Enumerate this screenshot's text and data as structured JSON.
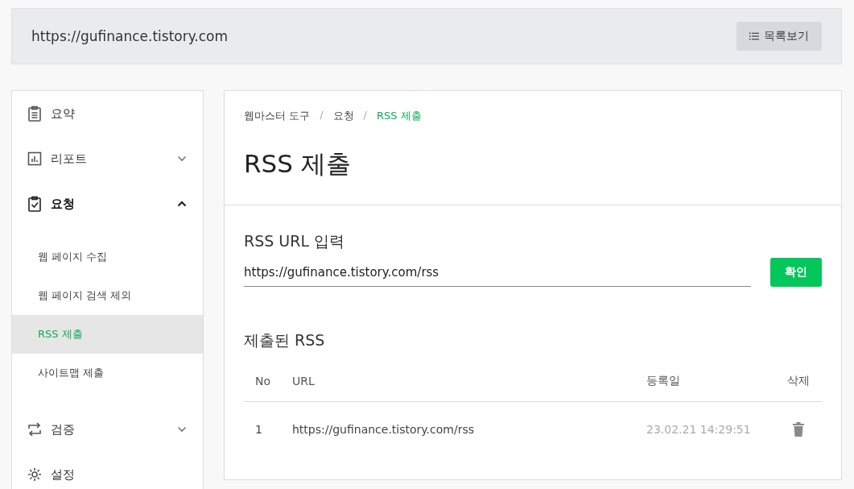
{
  "header": {
    "url": "https://gufinance.tistory.com",
    "list_button": "목록보기"
  },
  "sidebar": {
    "items": [
      {
        "label": "요약"
      },
      {
        "label": "리포트",
        "expanded": false
      },
      {
        "label": "요청",
        "expanded": true,
        "children": [
          {
            "label": "웹 페이지 수집",
            "selected": false
          },
          {
            "label": "웹 페이지 검색 제외",
            "selected": false
          },
          {
            "label": "RSS 제출",
            "selected": true
          },
          {
            "label": "사이트맵 제출",
            "selected": false
          }
        ]
      },
      {
        "label": "검증",
        "expanded": false
      },
      {
        "label": "설정"
      }
    ]
  },
  "breadcrumb": [
    {
      "label": "웹마스터 도구",
      "selected": false
    },
    {
      "separator": "/",
      "label": "요청",
      "selected": false
    },
    {
      "separator": "/",
      "label": "RSS 제출",
      "selected": true
    }
  ],
  "title": "RSS 제출",
  "form": {
    "label": "RSS URL 입력",
    "value": "https://gufinance.tistory.com/rss",
    "button": "확인"
  },
  "submitted": {
    "heading": "제출된 RSS",
    "columns": [
      "No",
      "URL",
      "등록일",
      "삭제"
    ],
    "rows": [
      {
        "no": "1",
        "url": "https://gufinance.tistory.com/rss",
        "date": "23.02.21 14:29:51"
      }
    ]
  }
}
